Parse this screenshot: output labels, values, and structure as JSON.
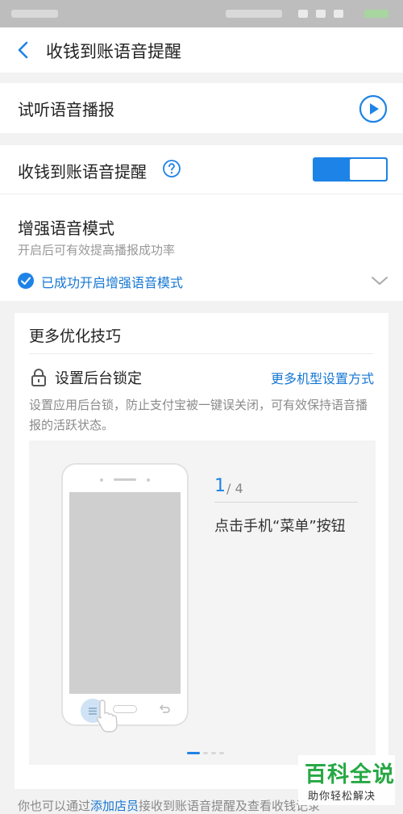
{
  "nav": {
    "title": "收钱到账语音提醒"
  },
  "preview": {
    "label": "试听语音播报"
  },
  "voice_alert": {
    "label": "收钱到账语音提醒",
    "enabled": true
  },
  "enhanced_mode": {
    "title": "增强语音模式",
    "subtitle": "开启后可有效提高播报成功率",
    "status": "已成功开启增强语音模式"
  },
  "tips": {
    "title": "更多优化技巧",
    "lock_label": "设置后台锁定",
    "more_models_link": "更多机型设置方式",
    "description": "设置应用后台锁，防止支付宝被一键误关闭，可有效保持语音播报的活跃状态。",
    "step": {
      "current": "1",
      "total": "/ 4",
      "text": "点击手机“菜单”按钮"
    },
    "pager": {
      "count": 4,
      "active": 0
    }
  },
  "footer": {
    "prefix": "你也可以通过",
    "link": "添加店员",
    "suffix": "接收到账语音提醒及查看收钱记录"
  },
  "watermark": {
    "main": "百科全说",
    "sub": "助你轻松解决"
  },
  "colors": {
    "accent": "#1e83e6",
    "link": "#1677d2",
    "watermark": "#27a844"
  }
}
